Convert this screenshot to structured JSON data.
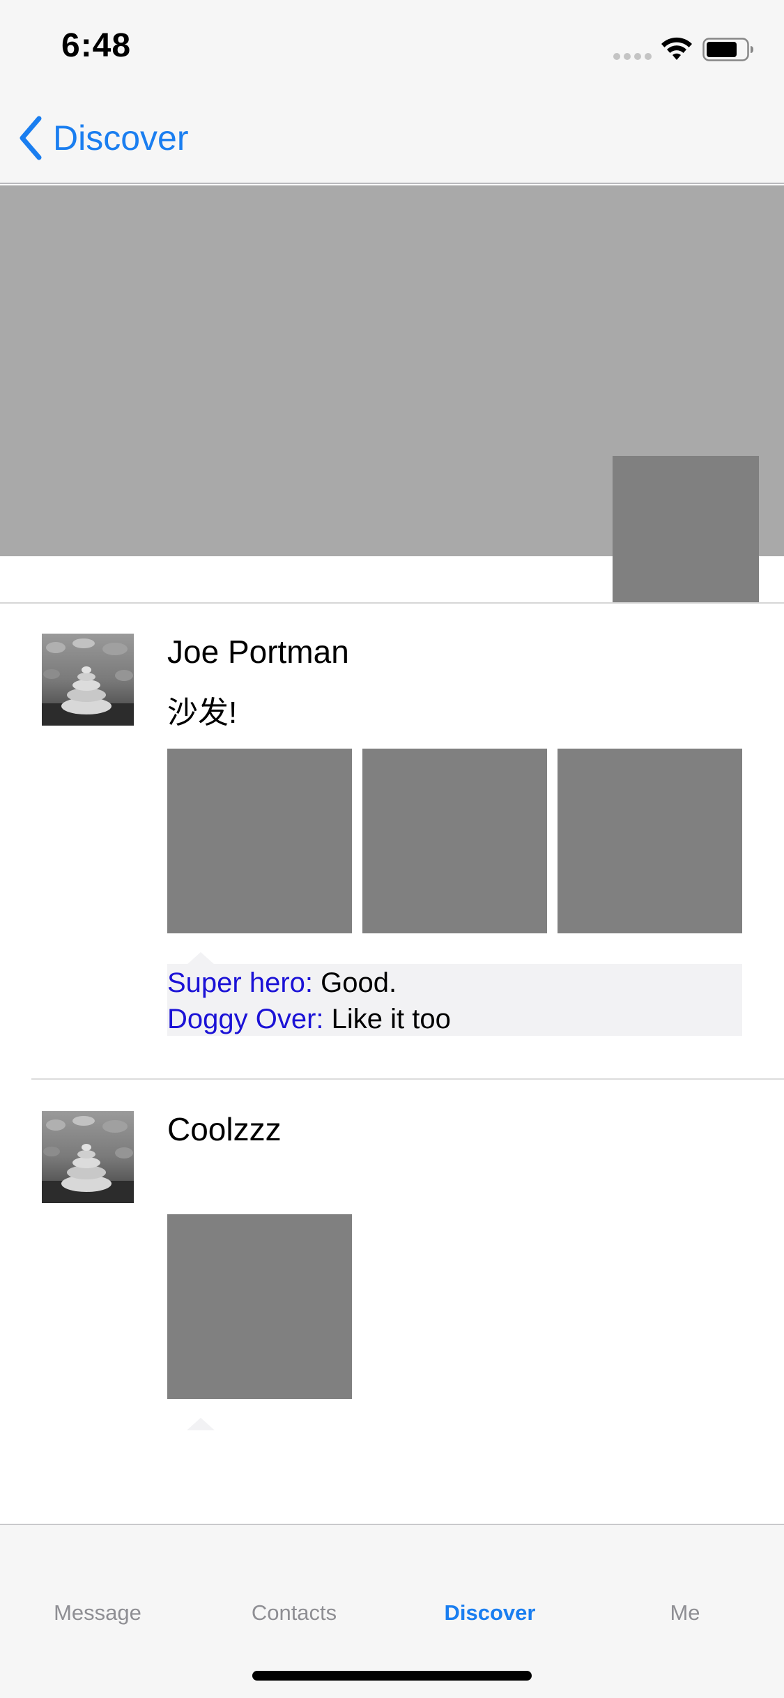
{
  "status_bar": {
    "time": "6:48"
  },
  "nav": {
    "back_label": "Discover"
  },
  "posts": [
    {
      "username": "Joe Portman",
      "text": "沙发!",
      "photo_count": 3,
      "comments": [
        {
          "author": "Super hero:",
          "text": " Good."
        },
        {
          "author": "Doggy Over:",
          "text": " Like it too"
        }
      ]
    },
    {
      "username": "Coolzzz",
      "text": "",
      "photo_count": 1,
      "comments": []
    }
  ],
  "tabs": [
    {
      "label": "Message",
      "active": false
    },
    {
      "label": "Contacts",
      "active": false
    },
    {
      "label": "Discover",
      "active": true
    },
    {
      "label": "Me",
      "active": false
    }
  ],
  "colors": {
    "accent": "#1a7ef0",
    "comment_author": "#1b12d6",
    "cover": "#a9a9a9",
    "placeholder": "#808080",
    "bar_background": "#f6f6f6"
  }
}
